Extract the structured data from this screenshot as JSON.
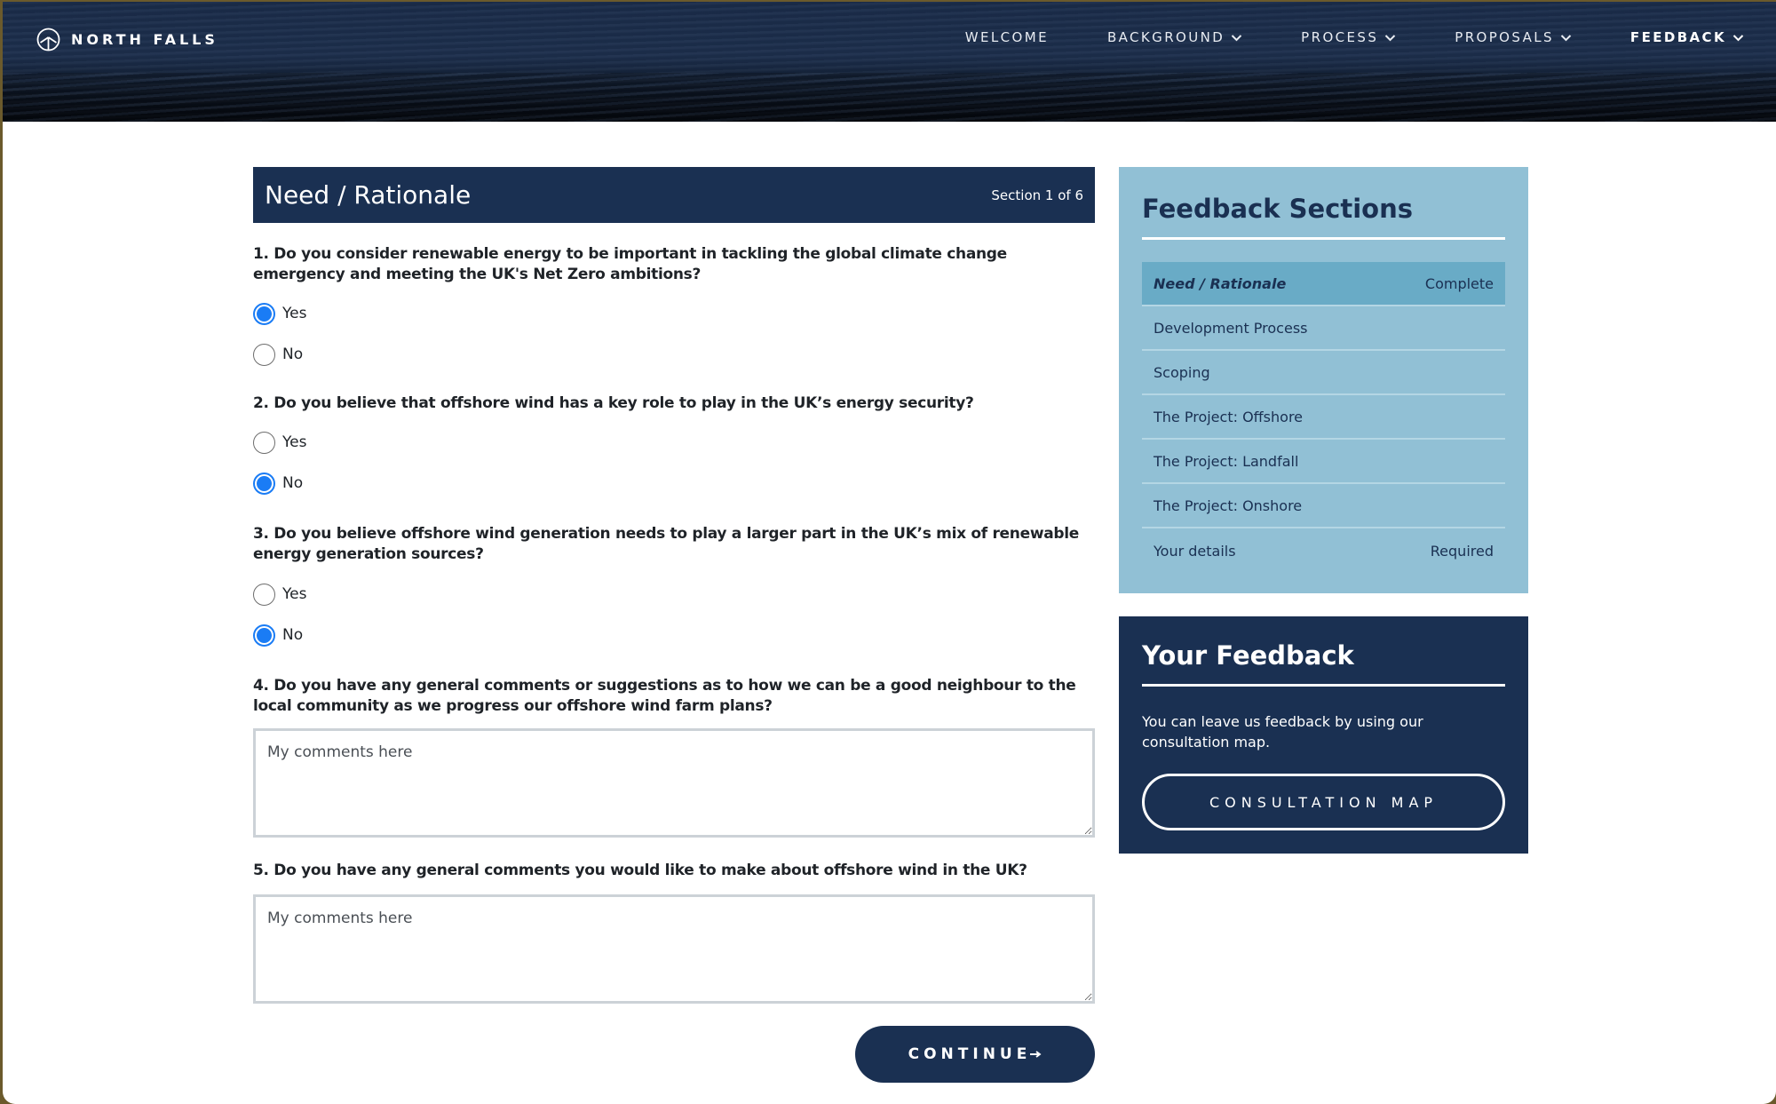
{
  "brand": {
    "name": "NORTH FALLS",
    "icon": "wind-turbine-circle-icon"
  },
  "nav": {
    "items": [
      {
        "label": "WELCOME",
        "has_dropdown": false,
        "active": false
      },
      {
        "label": "BACKGROUND",
        "has_dropdown": true,
        "active": false
      },
      {
        "label": "PROCESS",
        "has_dropdown": true,
        "active": false
      },
      {
        "label": "PROPOSALS",
        "has_dropdown": true,
        "active": false
      },
      {
        "label": "FEEDBACK",
        "has_dropdown": true,
        "active": true
      }
    ]
  },
  "form": {
    "section_title": "Need / Rationale",
    "section_counter": "Section 1 of 6",
    "questions": [
      {
        "text": "1. Do you consider renewable energy to be important in tackling the global climate change emergency and meeting the UK's Net Zero ambitions?",
        "options": [
          {
            "label": "Yes",
            "checked": true
          },
          {
            "label": "No",
            "checked": false
          }
        ]
      },
      {
        "text": "2. Do you believe that offshore wind has a key role to play in the UK’s energy security?",
        "options": [
          {
            "label": "Yes",
            "checked": false
          },
          {
            "label": "No",
            "checked": true
          }
        ]
      },
      {
        "text": "3. Do you believe offshore wind generation needs to play a larger part in the UK’s mix of renewable energy generation sources?",
        "options": [
          {
            "label": "Yes",
            "checked": false
          },
          {
            "label": "No",
            "checked": true
          }
        ]
      },
      {
        "text": "4. Do you have any general comments or suggestions as to how we can be a good neighbour to the local community as we progress our offshore wind farm plans?",
        "value": "",
        "placeholder": "My comments here"
      },
      {
        "text": "5. Do you have any general comments you would like to make about offshore wind in the UK?",
        "value": "",
        "placeholder": "My comments here"
      }
    ],
    "continue_label": "CONTINUE",
    "continue_icon": "arrow-right-icon"
  },
  "sidebar": {
    "sections_title": "Feedback Sections",
    "sections": [
      {
        "label": "Need / Rationale",
        "status": "Complete",
        "current": true
      },
      {
        "label": "Development Process",
        "status": "",
        "current": false
      },
      {
        "label": "Scoping",
        "status": "",
        "current": false
      },
      {
        "label": "The Project: Offshore",
        "status": "",
        "current": false
      },
      {
        "label": "The Project: Landfall",
        "status": "",
        "current": false
      },
      {
        "label": "The Project: Onshore",
        "status": "",
        "current": false
      },
      {
        "label": "Your details",
        "status": "Required",
        "current": false
      }
    ],
    "feedback_title": "Your Feedback",
    "feedback_text": "You can leave us feedback by using our consultation map.",
    "map_button_label": "CONSULTATION MAP"
  },
  "colors": {
    "navy": "#1a3052",
    "sidebar_blue": "#91c0d5",
    "sidebar_active": "#69abc6",
    "radio_accent": "#1a7cf5"
  }
}
